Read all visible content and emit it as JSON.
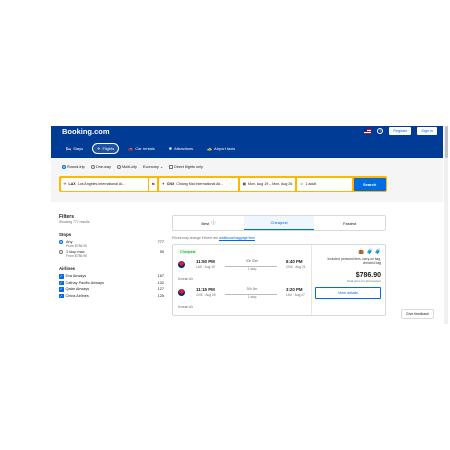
{
  "header": {
    "logo": "Booking.com",
    "register": "Register",
    "signin": "Sign in",
    "nav": [
      {
        "label": "Stays",
        "icon": "bed-icon",
        "glyph": "🛏"
      },
      {
        "label": "Flights",
        "icon": "plane-icon",
        "glyph": "✈"
      },
      {
        "label": "Car rentals",
        "icon": "car-icon",
        "glyph": "🚗"
      },
      {
        "label": "Attractions",
        "icon": "attractions-icon",
        "glyph": "✺"
      },
      {
        "label": "Airport taxis",
        "icon": "taxi-icon",
        "glyph": "🚕"
      }
    ]
  },
  "search": {
    "trip_options": [
      "Round-trip",
      "One-way",
      "Multi-city"
    ],
    "cabin": "Economy",
    "direct_only": "Direct flights only",
    "from_code": "LAX",
    "from_name": "Los Angeles International Ai...",
    "to_code": "CNX",
    "to_name": "Chiang Mai International Air...",
    "dates": "Mon, Aug 19 – Mon, Aug 26",
    "travelers": "1 adult",
    "button": "Search"
  },
  "filters": {
    "title": "Filters",
    "results": "Showing 777 results",
    "stops_title": "Stops",
    "stops": [
      {
        "label": "Any",
        "sub": "From $786.90",
        "count": "777"
      },
      {
        "label": "1 stop max",
        "sub": "From $786.90",
        "count": "59"
      }
    ],
    "airlines_title": "Airlines",
    "airlines": [
      {
        "label": "Eva Airways",
        "count": "167"
      },
      {
        "label": "Cathay Pacific Airways",
        "count": "132"
      },
      {
        "label": "Qatar Airways",
        "count": "127"
      },
      {
        "label": "China Airlines",
        "count": "125"
      }
    ]
  },
  "results": {
    "tabs": {
      "best": "Best",
      "cheapest": "Cheapest",
      "fastest": "Fastest"
    },
    "note_prefix": "Prices may change if there are",
    "note_link": "additional baggage fees",
    "card": {
      "badge": "Cheapest",
      "airline": "Korean Air",
      "outbound": {
        "dep_time": "11:50 PM",
        "dep_sub": "LAX · Aug 19",
        "duration": "30h 50m",
        "stops": "1 stop",
        "arr_time": "8:40 PM",
        "arr_sub": "CNX · Aug 21"
      },
      "return": {
        "dep_time": "11:15 PM",
        "dep_sub": "CNX · Aug 26",
        "duration": "30h 5m",
        "stops": "1 stop",
        "arr_time": "3:20 PM",
        "arr_sub": "LAX · Aug 27"
      },
      "bags_text": "Included: personal item, carry-on bag, checked bag",
      "price": "$786.90",
      "price_sub": "Total price for all travelers",
      "details": "View details"
    }
  },
  "feedback": "Give feedback"
}
